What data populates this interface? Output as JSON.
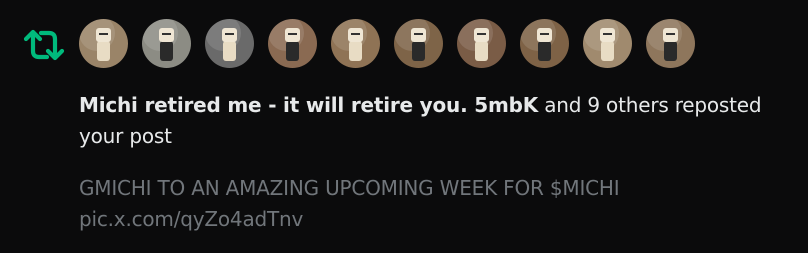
{
  "notification": {
    "type_icon": "repost-icon",
    "accent_color": "#00ba7c",
    "avatars": [
      {
        "icon": "avatar-figure-icon",
        "tone": "#9a8468"
      },
      {
        "icon": "avatar-figure-icon",
        "tone": "#8c8c84"
      },
      {
        "icon": "avatar-figure-icon",
        "tone": "#6a6a6a"
      },
      {
        "icon": "avatar-figure-icon",
        "tone": "#8a6a52"
      },
      {
        "icon": "avatar-figure-icon",
        "tone": "#8f7355"
      },
      {
        "icon": "avatar-figure-icon",
        "tone": "#7e6448"
      },
      {
        "icon": "avatar-figure-icon",
        "tone": "#7a5c46"
      },
      {
        "icon": "avatar-figure-icon",
        "tone": "#7e6246"
      },
      {
        "icon": "avatar-figure-icon",
        "tone": "#a08a6e"
      },
      {
        "icon": "avatar-figure-icon",
        "tone": "#8e765c"
      }
    ],
    "actor_name": "Michi retired me - it will retire you. 5mbK",
    "action_text": " and 9 others reposted your post",
    "post_text": "GMICHI TO AN AMAZING UPCOMING WEEK FOR $MICHI",
    "post_link": "pic.x.com/qyZo4adTnv"
  }
}
